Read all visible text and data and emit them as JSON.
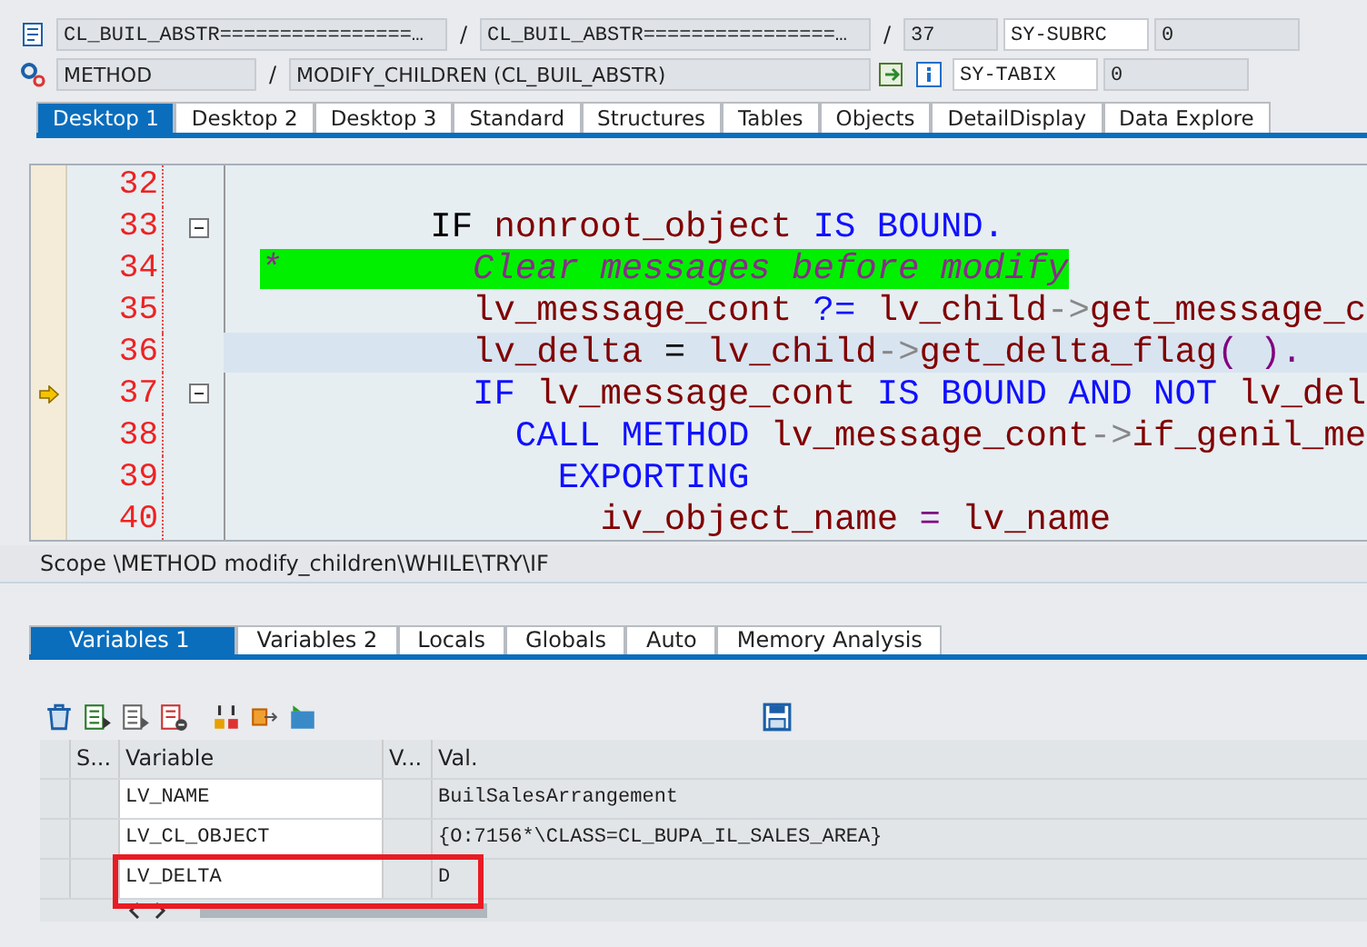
{
  "header": {
    "row1": {
      "program": "CL_BUIL_ABSTR================…",
      "include": "CL_BUIL_ABSTR================…",
      "sep1": "/",
      "sep2": "/",
      "line": "37",
      "sysvar": "SY-SUBRC",
      "sysval": "0"
    },
    "row2": {
      "type": "METHOD",
      "sep": "/",
      "name": "MODIFY_CHILDREN (CL_BUIL_ABSTR)",
      "sysvar": "SY-TABIX",
      "sysval": "0"
    }
  },
  "desktop_tabs": [
    {
      "label": "Desktop 1",
      "selected": true
    },
    {
      "label": "Desktop 2",
      "selected": false
    },
    {
      "label": "Desktop 3",
      "selected": false
    },
    {
      "label": "Standard",
      "selected": false
    },
    {
      "label": "Structures",
      "selected": false
    },
    {
      "label": "Tables",
      "selected": false
    },
    {
      "label": "Objects",
      "selected": false
    },
    {
      "label": "DetailDisplay",
      "selected": false
    },
    {
      "label": "Data Explore",
      "selected": false
    }
  ],
  "code_lines": [
    {
      "number": "32",
      "current": false,
      "marker": false,
      "fold": false
    },
    {
      "number": "33",
      "current": false,
      "marker": false,
      "fold": true,
      "tokens": [
        {
          "kind": "plain",
          "text": "        IF"
        },
        {
          "kind": "id",
          "text": " nonroot_object"
        },
        {
          "kind": "kw",
          "text": " IS BOUND."
        }
      ]
    },
    {
      "number": "34",
      "current": false,
      "marker": false,
      "fold": false,
      "tokens": [
        {
          "kind": "comment",
          "text": "*         Clear messages before modify"
        }
      ]
    },
    {
      "number": "35",
      "current": false,
      "marker": false,
      "fold": false,
      "tokens": [
        {
          "kind": "id",
          "text": "          lv_message_cont"
        },
        {
          "kind": "kw",
          "text": " ?="
        },
        {
          "kind": "id",
          "text": " lv_child"
        },
        {
          "kind": "arrow",
          "text": "->"
        },
        {
          "kind": "id",
          "text": "get_message_c"
        }
      ]
    },
    {
      "number": "36",
      "current": true,
      "marker": false,
      "fold": false,
      "tokens": [
        {
          "kind": "id",
          "text": "          lv_delta"
        },
        {
          "kind": "plain",
          "text": " ="
        },
        {
          "kind": "id",
          "text": " lv_child"
        },
        {
          "kind": "arrow",
          "text": "->"
        },
        {
          "kind": "id",
          "text": "get_delta_flag"
        },
        {
          "kind": "op",
          "text": "( )."
        }
      ]
    },
    {
      "number": "37",
      "current": false,
      "marker": true,
      "fold": true,
      "tokens": [
        {
          "kind": "kw",
          "text": "          IF"
        },
        {
          "kind": "id",
          "text": " lv_message_cont"
        },
        {
          "kind": "kw",
          "text": " IS BOUND AND NOT"
        },
        {
          "kind": "id",
          "text": " lv_del"
        }
      ]
    },
    {
      "number": "38",
      "current": false,
      "marker": false,
      "fold": false,
      "tokens": [
        {
          "kind": "kw",
          "text": "            CALL METHOD"
        },
        {
          "kind": "id",
          "text": " lv_message_cont"
        },
        {
          "kind": "arrow",
          "text": "->"
        },
        {
          "kind": "id",
          "text": "if_genil_me"
        }
      ]
    },
    {
      "number": "39",
      "current": false,
      "marker": false,
      "fold": false,
      "tokens": [
        {
          "kind": "kw",
          "text": "              EXPORTING"
        }
      ]
    },
    {
      "number": "40",
      "current": false,
      "marker": false,
      "fold": false,
      "tokens": [
        {
          "kind": "id",
          "text": "                iv_object_name"
        },
        {
          "kind": "op",
          "text": " ="
        },
        {
          "kind": "id",
          "text": " lv_name"
        }
      ]
    }
  ],
  "scope": "Scope \\METHOD modify_children\\WHILE\\TRY\\IF",
  "variable_tabs": [
    {
      "label": "Variables 1",
      "selected": true
    },
    {
      "label": "Variables 2",
      "selected": false
    },
    {
      "label": "Locals",
      "selected": false
    },
    {
      "label": "Globals",
      "selected": false
    },
    {
      "label": "Auto",
      "selected": false
    },
    {
      "label": "Memory Analysis",
      "selected": false
    }
  ],
  "table": {
    "columns": [
      "S...",
      "Variable",
      "V...",
      "Val."
    ],
    "rows": [
      {
        "variable": "LV_NAME",
        "value": "BuilSalesArrangement",
        "highlighted": false
      },
      {
        "variable": "LV_CL_OBJECT",
        "value": "{O:7156*\\CLASS=CL_BUPA_IL_SALES_AREA}",
        "highlighted": false
      },
      {
        "variable": "LV_DELTA",
        "value": "D",
        "highlighted": true
      }
    ]
  }
}
